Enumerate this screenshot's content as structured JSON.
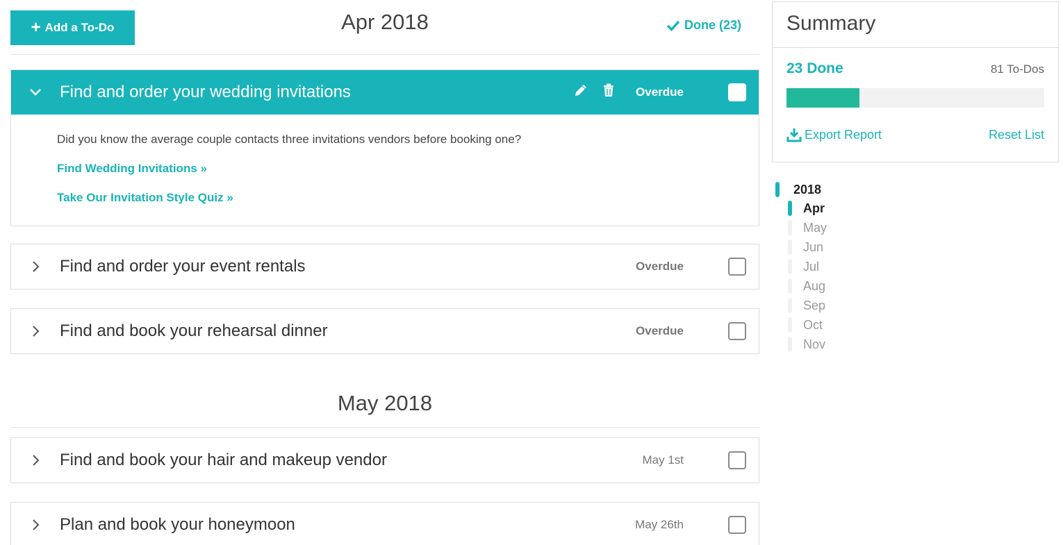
{
  "toolbar": {
    "add_label": "Add a To-Do",
    "done_label": "Done (23)"
  },
  "sections": [
    {
      "title": "Apr 2018"
    },
    {
      "title": "May 2018"
    }
  ],
  "tasks": [
    {
      "title": "Find and order your wedding invitations",
      "status": "Overdue",
      "expanded": true,
      "body": "Did you know the average couple contacts three invitations vendors before booking one?",
      "links": [
        "Find Wedding Invitations »",
        "Take Our Invitation Style Quiz »"
      ]
    },
    {
      "title": "Find and order your event rentals",
      "status": "Overdue"
    },
    {
      "title": "Find and book your rehearsal dinner",
      "status": "Overdue"
    },
    {
      "title": "Find and book your hair and makeup vendor",
      "status": "May 1st"
    },
    {
      "title": "Plan and book your honeymoon",
      "status": "May 26th"
    }
  ],
  "summary": {
    "title": "Summary",
    "done_label": "23 Done",
    "total_label": "81 To-Dos",
    "progress_fraction": 0.284,
    "export_label": "Export Report",
    "reset_label": "Reset List"
  },
  "timeline": {
    "year": "2018",
    "months": [
      "Apr",
      "May",
      "Jun",
      "Jul",
      "Aug",
      "Sep",
      "Oct",
      "Nov"
    ],
    "active_month": "Apr"
  },
  "colors": {
    "accent": "#19b4b9",
    "progress": "#22b99a"
  }
}
